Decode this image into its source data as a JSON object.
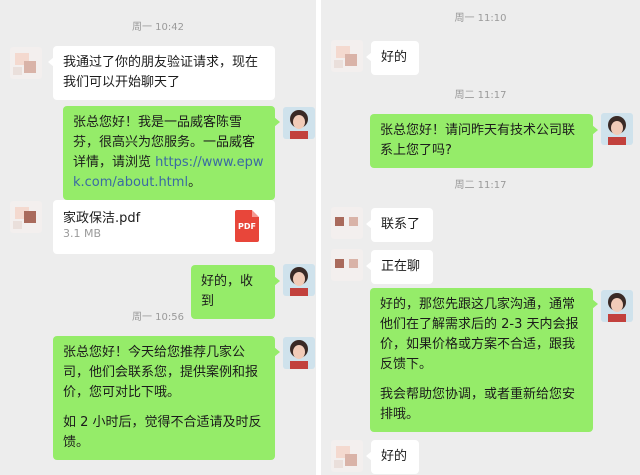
{
  "left": {
    "timestamps": [
      "周一 10:42",
      "周一 10:56"
    ],
    "messages": [
      {
        "text": "我通过了你的朋友验证请求，现在我们可以开始聊天了"
      },
      {
        "text_before": "张总您好！我是一品威客陈雪芬，很高兴为您服务。一品威客详情，请浏览 ",
        "link": "https://www.epwk.com/about.html",
        "text_after": "。"
      },
      {
        "text": "好的，收到"
      },
      {
        "text": "张总您好！今天给您推荐几家公司，他们会联系您，提供案例和报价，您可对比下哦。",
        "text2": "如 2 小时后，觉得不合适请及时反馈。"
      }
    ],
    "file": {
      "name": "家政保洁.pdf",
      "size": "3.1 MB",
      "icon_label": "PDF"
    }
  },
  "right": {
    "timestamps": [
      "周一 11:10",
      "周二 11:17",
      "周二 11:17"
    ],
    "messages": [
      {
        "text": "好的"
      },
      {
        "text": "张总您好！请问昨天有技术公司联系上您了吗?"
      },
      {
        "text": "联系了"
      },
      {
        "text": "正在聊"
      },
      {
        "text": "好的，那您先跟这几家沟通，通常他们在了解需求后的 2-3 天内会报价，如果价格或方案不合适，跟我反馈下。",
        "text2": "我会帮助您协调，或者重新给您安排哦。"
      },
      {
        "text": "好的"
      }
    ]
  },
  "colors": {
    "background": "#ededed",
    "green_bubble": "#95ec69",
    "white_bubble": "#ffffff",
    "link": "#3b6aa3",
    "pdf_red": "#e8463a"
  }
}
